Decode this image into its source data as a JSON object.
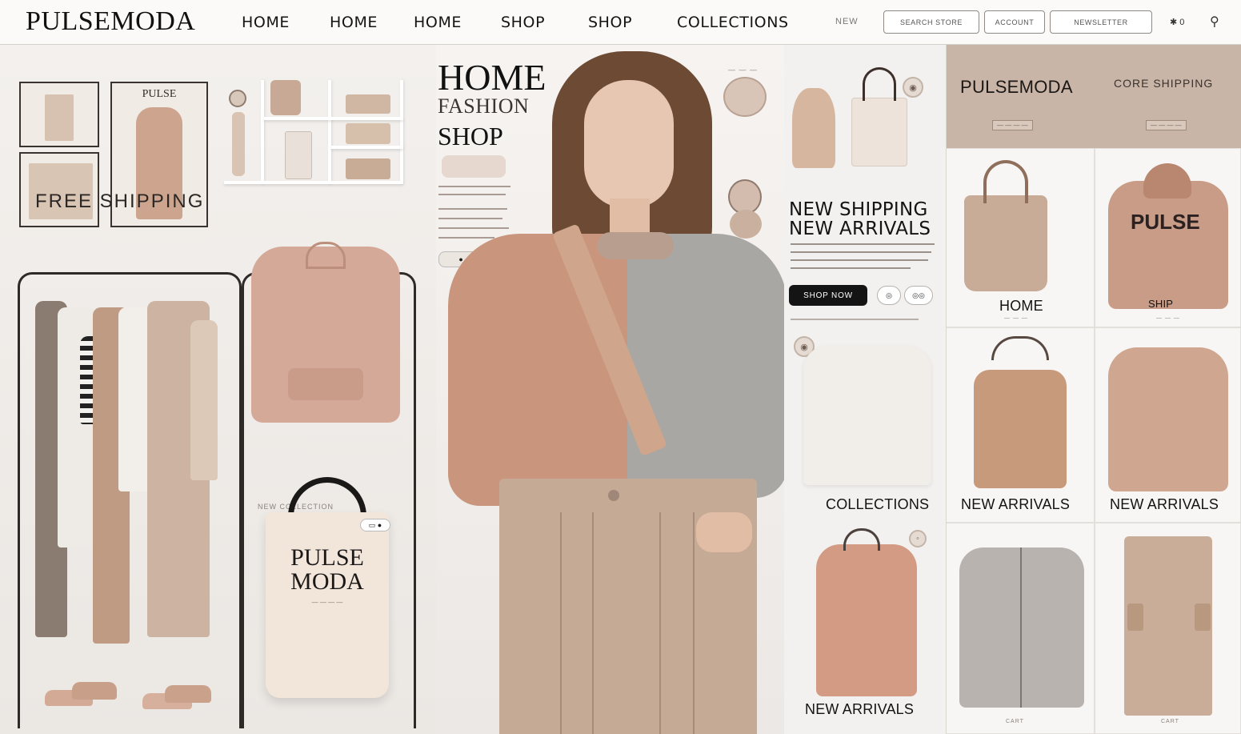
{
  "header": {
    "brand": "PULSEMODA",
    "nav": [
      "HOME",
      "HOME",
      "HOME",
      "SHOP",
      "SHOP",
      "COLLECTIONS"
    ],
    "nav_new": "NEW",
    "buttons": [
      "SEARCH STORE",
      "ACCOUNT",
      "NEWSLETTER"
    ],
    "icons": {
      "cart": "cart-icon",
      "search": "search-icon"
    },
    "cart_glyph": "✱ 0",
    "search_glyph": "⚲"
  },
  "left": {
    "free_shipping": "FREE SHIPPING",
    "poster_label": "PULSE",
    "tote_brand_line1": "PULSE",
    "tote_brand_line2": "MODA",
    "new_collection_caption": "NEW COLLECTION"
  },
  "hero": {
    "title_home": "HOME",
    "title_fashion": "FASHION",
    "title_shop": "SHOP"
  },
  "product_column": {
    "heading_line1": "NEW SHIPPING",
    "heading_line2": "NEW ARRIVALS",
    "shop_now": "SHOP NOW",
    "mini_buttons": [
      "◎",
      "◎◎"
    ],
    "labels": {
      "collections": "COLLECTIONS",
      "new_arrivals": "NEW ARRIVALS"
    }
  },
  "grid": {
    "banner_title": "PULSEMODA",
    "banner_sub": "CORE SHIPPING",
    "cards": [
      {
        "label": "HOME",
        "graphic": "PULSE"
      },
      {
        "label": "SHIP"
      },
      {
        "label": "NEW ARRIVALS"
      },
      {
        "label": "NEW ARRIVALS"
      },
      {
        "label": "CART"
      },
      {
        "label": "CART"
      }
    ]
  },
  "colors": {
    "accent_dark": "#141414",
    "beige": "#c9b5a7",
    "blush": "#d4a998",
    "taupe": "#c5aa96",
    "grey_knit": "#a9a7a3"
  }
}
